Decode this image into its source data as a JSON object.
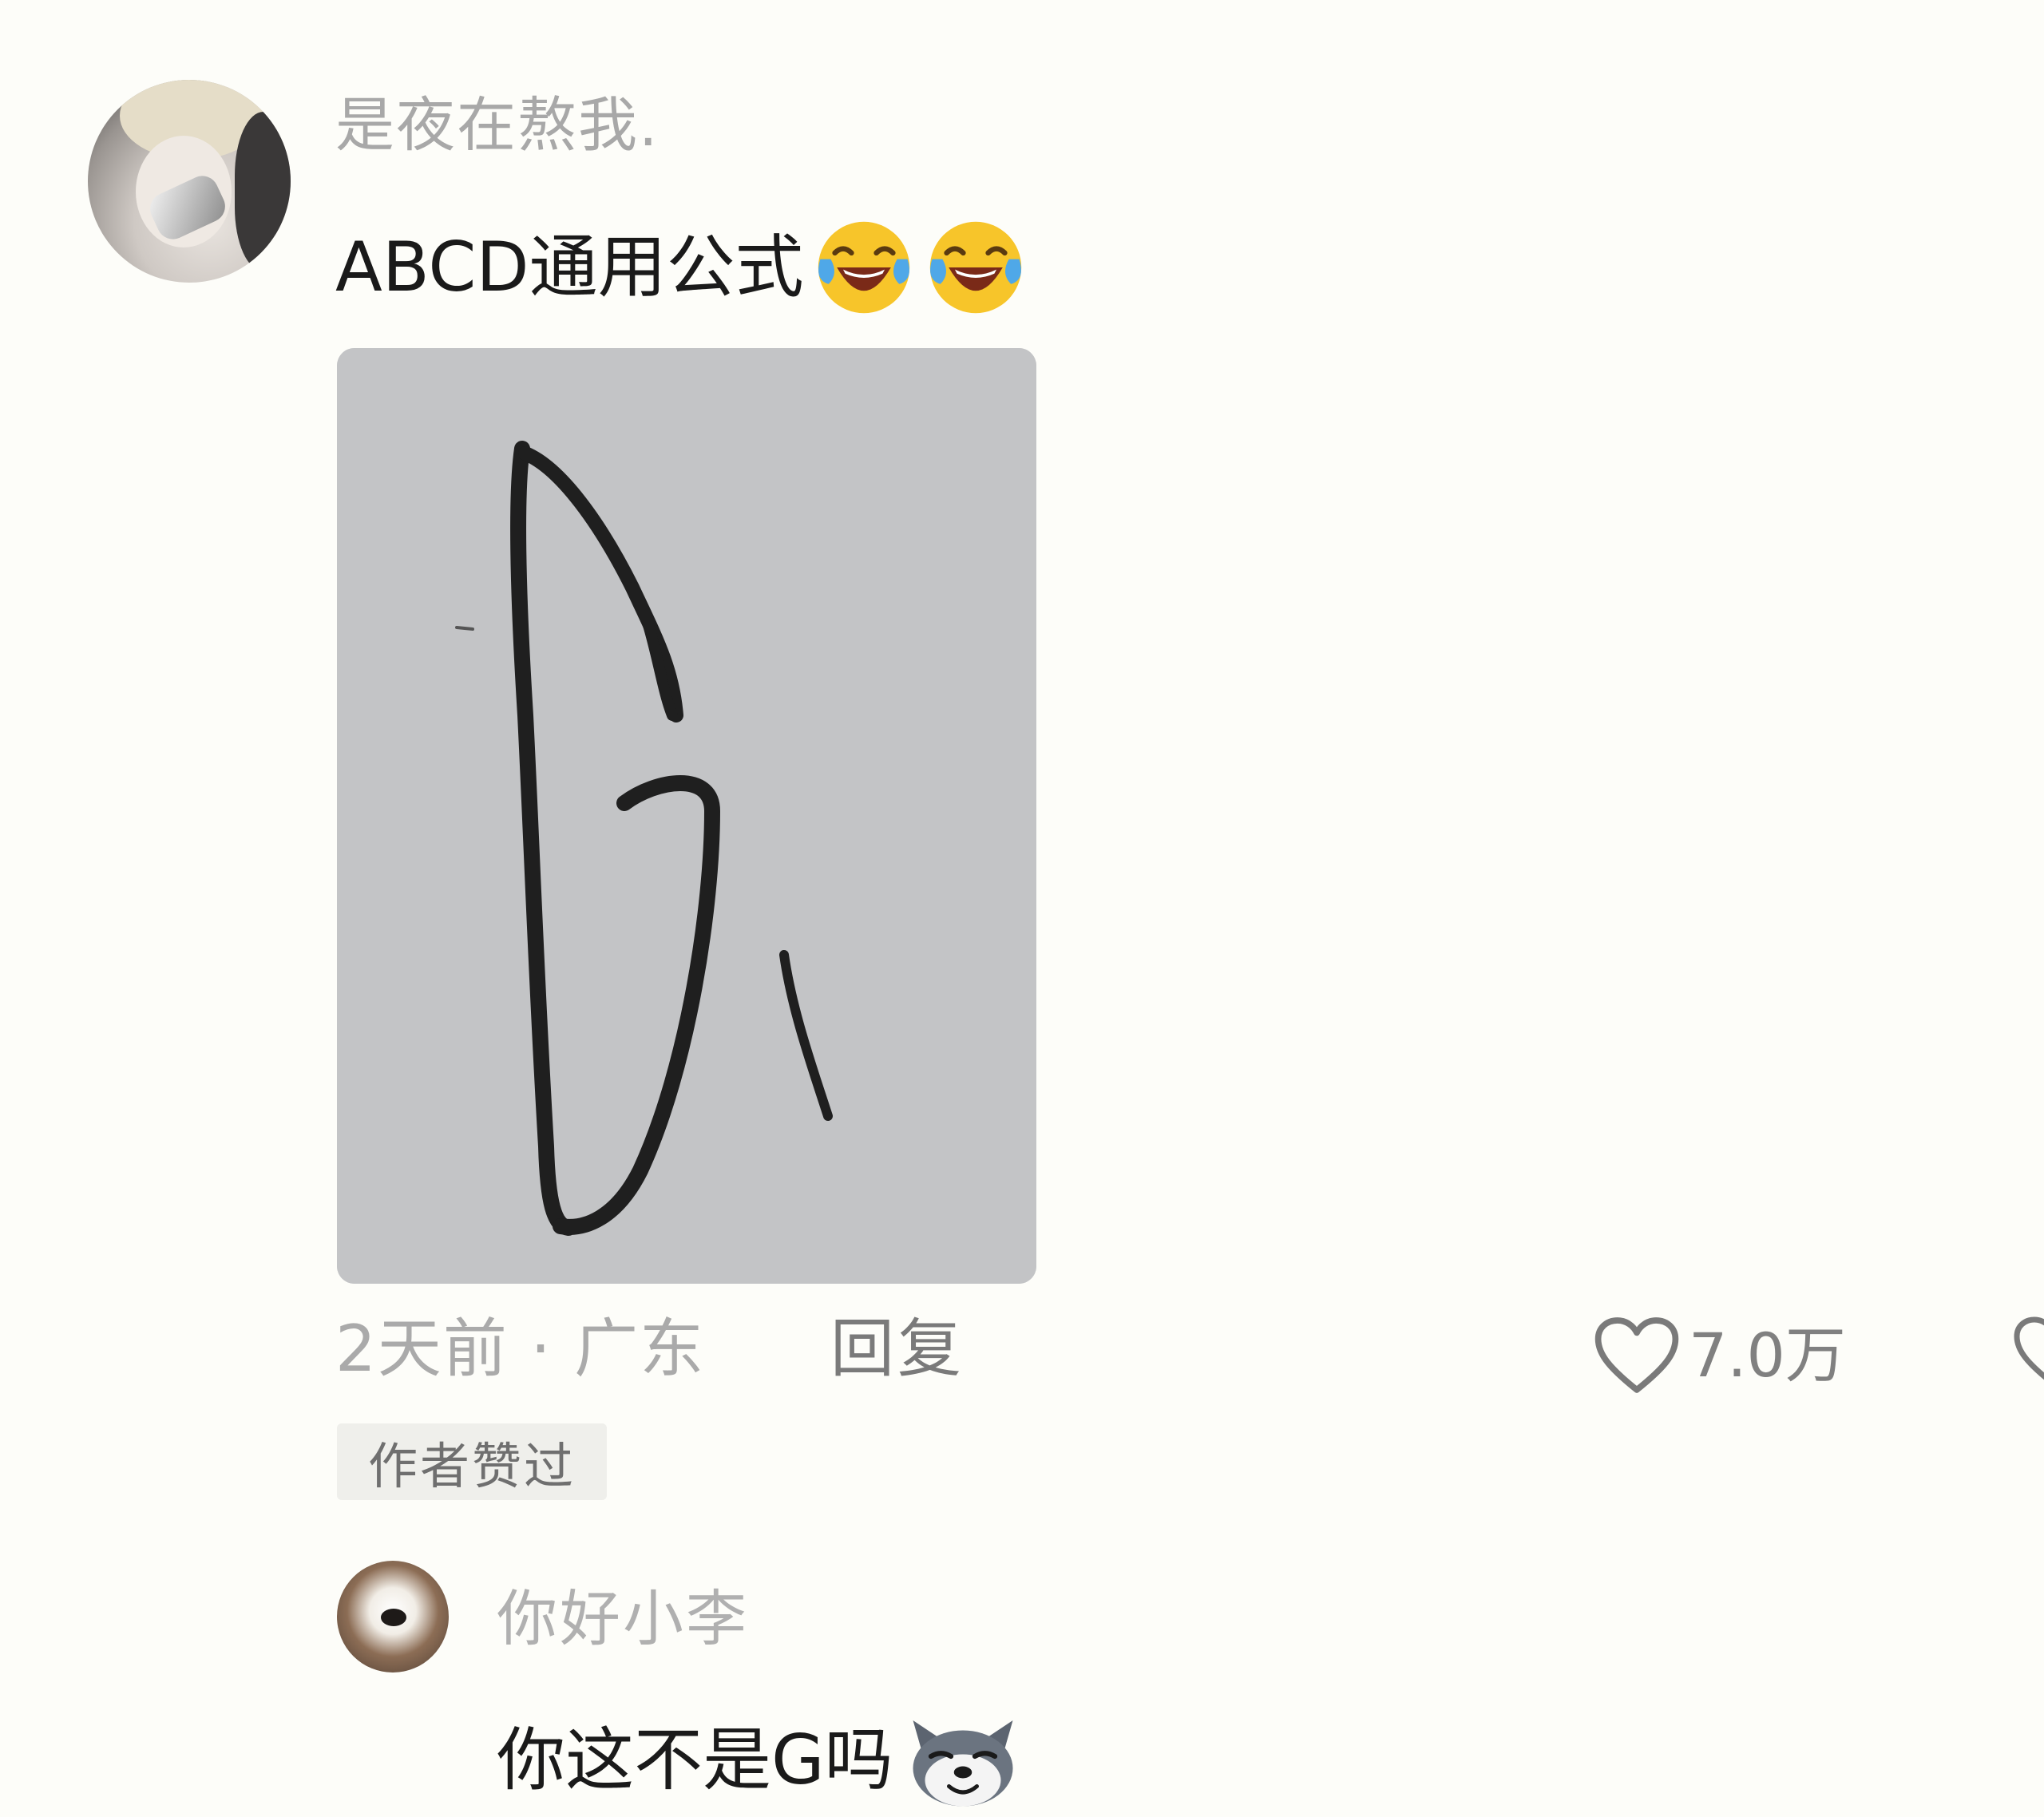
{
  "comment": {
    "username": "是夜在熬我.",
    "text": "ABCD通用公式",
    "emojis": [
      "laugh-cry-emoji",
      "laugh-cry-emoji"
    ],
    "time_location": "2天前 · 广东",
    "reply_label": "回复",
    "like_count": "7.0万",
    "author_liked_badge": "作者赞过"
  },
  "reply": {
    "username": "你好小李",
    "text": "你这不是G吗",
    "emoji": "husky-emoji"
  },
  "colors": {
    "background": "#fdfdf9",
    "username": "#a8a8a8",
    "body_text": "#1a1a1a",
    "meta_text": "#aaaaaa",
    "badge_bg": "#efefeb",
    "image_bg": "#c4c5c7",
    "ink": "#2a2a2a"
  }
}
